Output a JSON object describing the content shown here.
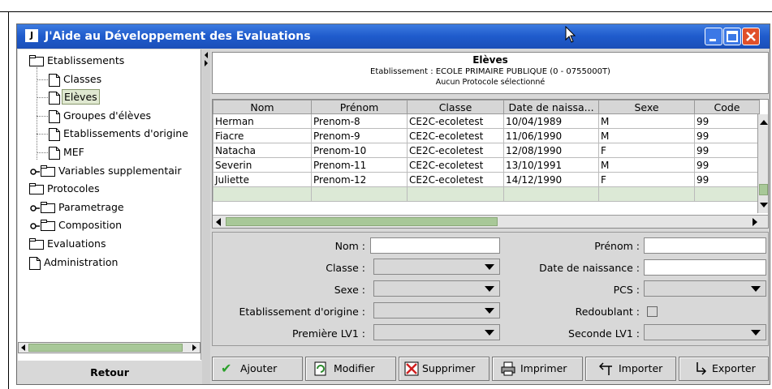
{
  "window": {
    "title": "J'Aide au Développement des Evaluations",
    "icon_text": "J"
  },
  "tree": [
    {
      "label": "Etablissements",
      "icon": "folder-icon",
      "expander": false
    },
    {
      "label": "Classes",
      "icon": "document-icon",
      "expander": false
    },
    {
      "label": "Elèves",
      "icon": "document-icon",
      "expander": false,
      "selected": true
    },
    {
      "label": "Groupes d'élèves",
      "icon": "document-icon",
      "expander": false
    },
    {
      "label": "Etablissements d'origine",
      "icon": "document-icon",
      "expander": false
    },
    {
      "label": "MEF",
      "icon": "document-icon",
      "expander": false
    },
    {
      "label": "Variables supplementair",
      "icon": "folder-icon",
      "expander": true
    },
    {
      "label": "Protocoles",
      "icon": "folder-icon",
      "expander": false
    },
    {
      "label": "Parametrage",
      "icon": "folder-icon",
      "expander": true
    },
    {
      "label": "Composition",
      "icon": "folder-icon",
      "expander": true
    },
    {
      "label": "Evaluations",
      "icon": "folder-icon",
      "expander": false
    },
    {
      "label": "Administration",
      "icon": "document-icon",
      "expander": false
    }
  ],
  "retour_label": "Retour",
  "header": {
    "title": "Elèves",
    "etablissement": "Etablissement : ECOLE PRIMAIRE PUBLIQUE  (0 - 0755000T)",
    "protocole": "Aucun Protocole sélectionné"
  },
  "grid": {
    "columns": [
      "Nom",
      "Prénom",
      "Classe",
      "Date de naissa...",
      "Sexe",
      "Code"
    ],
    "rows": [
      [
        "Herman",
        "Prenom-8",
        "CE2C-ecoletest",
        "10/04/1989",
        "M",
        "99"
      ],
      [
        "Fiacre",
        "Prenom-9",
        "CE2C-ecoletest",
        "11/06/1990",
        "M",
        "99"
      ],
      [
        "Natacha",
        "Prenom-10",
        "CE2C-ecoletest",
        "12/08/1990",
        "F",
        "99"
      ],
      [
        "Severin",
        "Prenom-11",
        "CE2C-ecoletest",
        "13/10/1991",
        "M",
        "99"
      ],
      [
        "Juliette",
        "Prenom-12",
        "CE2C-ecoletest",
        "14/12/1990",
        "F",
        "99"
      ]
    ]
  },
  "form": {
    "nom": {
      "label": "Nom :",
      "value": ""
    },
    "prenom": {
      "label": "Prénom :",
      "value": ""
    },
    "classe": {
      "label": "Classe :",
      "value": ""
    },
    "date_naissance": {
      "label": "Date de naissance :",
      "value": ""
    },
    "sexe": {
      "label": "Sexe :",
      "value": ""
    },
    "pcs": {
      "label": "PCS :",
      "value": ""
    },
    "etab_origine": {
      "label": "Etablissement d'origine :",
      "value": ""
    },
    "redoublant": {
      "label": "Redoublant :",
      "checked": false
    },
    "lv1": {
      "label": "Première LV1 :",
      "value": ""
    },
    "lv2": {
      "label": "Seconde LV1 :",
      "value": ""
    }
  },
  "toolbar": {
    "ajouter": "Ajouter",
    "modifier": "Modifier",
    "supprimer": "Supprimer",
    "imprimer": "Imprimer",
    "importer": "Importer",
    "exporter": "Exporter"
  },
  "colors": {
    "titlebar": "#1f5bcc",
    "selection": "#dfe8d0",
    "scroll_thumb": "#a8c898"
  }
}
